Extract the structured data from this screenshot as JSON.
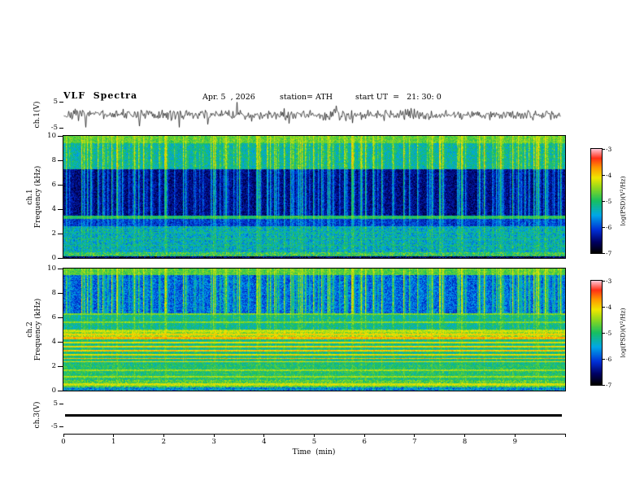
{
  "header": {
    "title": "VLF  Spectra",
    "date": "Apr. 5  , 2026",
    "station": "station= ATH",
    "start_ut": "start UT  =   21: 30: 0"
  },
  "time_axis": {
    "label": "Time  (min)",
    "range": [
      0,
      10
    ],
    "ticks": [
      0,
      1,
      2,
      3,
      4,
      5,
      6,
      7,
      8,
      9,
      10
    ],
    "tick_labels": [
      "0",
      "1",
      "2",
      "3",
      "4",
      "5",
      "6",
      "7",
      "8",
      "9"
    ]
  },
  "colorbar": {
    "label": "log(PSD)(V²/Hz)",
    "tick_labels": [
      "-3",
      "-4",
      "-5",
      "-6",
      "-7"
    ],
    "range": [
      -7,
      -3
    ],
    "stops": [
      [
        0.0,
        "#000000"
      ],
      [
        0.1,
        "#000060"
      ],
      [
        0.22,
        "#0030d8"
      ],
      [
        0.36,
        "#00a8e8"
      ],
      [
        0.5,
        "#18c060"
      ],
      [
        0.62,
        "#8cd820"
      ],
      [
        0.72,
        "#f0e800"
      ],
      [
        0.82,
        "#ff9800"
      ],
      [
        0.91,
        "#ff3018"
      ],
      [
        1.0,
        "#ffc8d8"
      ]
    ]
  },
  "panels": {
    "ch1_wave": {
      "ylabel": "ch.1(V)",
      "ylim": [
        -5,
        5
      ],
      "yticks": [
        5,
        -5
      ],
      "ytick_labels": [
        "5",
        "-5"
      ]
    },
    "ch1_spec": {
      "channel": "ch.1",
      "ylabel": "Frequency  (kHz)",
      "ylim": [
        0,
        10
      ],
      "yticks": [
        10,
        8,
        6,
        4,
        2,
        0
      ],
      "ytick_labels": [
        "10",
        "8",
        "6",
        "4",
        "2",
        "0"
      ]
    },
    "ch2_spec": {
      "channel": "ch.2",
      "ylabel": "Frequency  (kHz)",
      "ylim": [
        0,
        10
      ],
      "yticks": [
        10,
        8,
        6,
        4,
        2,
        0
      ],
      "ytick_labels": [
        "10",
        "8",
        "6",
        "4",
        "2",
        "0"
      ]
    },
    "ch3_wave": {
      "ylabel": "ch.3(V)",
      "ylim": [
        -5,
        5
      ],
      "yticks": [
        5,
        -5
      ],
      "ytick_labels": [
        "5",
        "-5"
      ]
    }
  },
  "chart_data": [
    {
      "type": "line",
      "name": "ch.1 voltage waveform",
      "ylabel": "ch.1(V)",
      "xlabel": "Time (min)",
      "xlim": [
        0,
        10
      ],
      "ylim": [
        -5,
        5
      ],
      "summary": "continuous broadband noise about 0 V, rms ~1 V, impulsive sferic spikes to about +/-4 V",
      "gen": {
        "seed": 7,
        "rms": 0.95,
        "spike_prob": 0.03,
        "spike_amp": [
          2.0,
          4.3
        ],
        "clip": 4.8
      }
    },
    {
      "type": "heatmap",
      "name": "ch.1 spectrogram",
      "ylabel": "Frequency (kHz)",
      "xlabel": "Time (min)",
      "zlabel": "log(PSD)(V²/Hz)",
      "xlim": [
        0,
        10
      ],
      "ylim": [
        0,
        10
      ],
      "zlim": [
        -7,
        -3
      ],
      "noise_seed": 3,
      "streaks": {
        "seed": 11,
        "prob": 0.22,
        "amp": [
          0.4,
          1.35
        ],
        "decay": 0.45
      },
      "bands": [
        {
          "f": [
            0.0,
            0.15
          ],
          "level": -6.6,
          "sigma": 0.5,
          "streak": 0.05
        },
        {
          "f": [
            0.15,
            0.45
          ],
          "level": -4.95,
          "sigma": 0.55,
          "streak": 0.1
        },
        {
          "f": [
            0.45,
            2.6
          ],
          "level": -5.45,
          "sigma": 0.5,
          "streak": 0.3
        },
        {
          "f": [
            2.6,
            3.2
          ],
          "level": -6.15,
          "sigma": 0.35,
          "streak": 0.5
        },
        {
          "f": [
            3.2,
            3.5
          ],
          "level": -5.05,
          "sigma": 0.25,
          "streak": 0.3
        },
        {
          "f": [
            3.5,
            7.3
          ],
          "level": -6.55,
          "sigma": 0.3,
          "streak": 1.15
        },
        {
          "f": [
            7.3,
            9.4
          ],
          "level": -5.35,
          "sigma": 0.4,
          "streak": 0.9
        },
        {
          "f": [
            9.4,
            10.01
          ],
          "level": -4.75,
          "sigma": 0.3,
          "streak": 0.4
        }
      ],
      "lines": [
        {
          "f": 1.05,
          "level": -5.15,
          "w": 0.08
        },
        {
          "f": 1.55,
          "level": -5.1,
          "w": 0.08
        },
        {
          "f": 2.1,
          "level": -5.2,
          "w": 0.08
        }
      ]
    },
    {
      "type": "heatmap",
      "name": "ch.2 spectrogram",
      "ylabel": "Frequency (kHz)",
      "xlabel": "Time (min)",
      "zlabel": "log(PSD)(V²/Hz)",
      "xlim": [
        0,
        10
      ],
      "ylim": [
        0,
        10
      ],
      "zlim": [
        -7,
        -3
      ],
      "noise_seed": 5,
      "streaks": {
        "seed": 11,
        "prob": 0.22,
        "amp": [
          0.4,
          1.35
        ],
        "decay": 0.45
      },
      "bands": [
        {
          "f": [
            0.0,
            0.3
          ],
          "level": -5.6,
          "sigma": 0.55,
          "streak": 0.05
        },
        {
          "f": [
            0.3,
            0.9
          ],
          "level": -4.8,
          "sigma": 0.45,
          "streak": 0.1
        },
        {
          "f": [
            0.9,
            2.1
          ],
          "level": -5.05,
          "sigma": 0.35,
          "streak": 0.15
        },
        {
          "f": [
            2.1,
            4.2
          ],
          "level": -5.15,
          "sigma": 0.35,
          "streak": 0.2
        },
        {
          "f": [
            4.2,
            5.0
          ],
          "level": -4.5,
          "sigma": 0.35,
          "streak": 0.2
        },
        {
          "f": [
            5.0,
            6.3
          ],
          "level": -5.25,
          "sigma": 0.35,
          "streak": 0.4
        },
        {
          "f": [
            6.3,
            9.5
          ],
          "level": -5.95,
          "sigma": 0.4,
          "streak": 1.25
        },
        {
          "f": [
            9.5,
            10.01
          ],
          "level": -4.8,
          "sigma": 0.3,
          "streak": 0.4
        }
      ],
      "lines": [
        {
          "f": 0.5,
          "level": -4.25,
          "w": 0.15
        },
        {
          "f": 1.15,
          "level": -4.45,
          "w": 0.12
        },
        {
          "f": 1.65,
          "level": -4.45,
          "w": 0.12
        },
        {
          "f": 2.35,
          "level": -4.1,
          "w": 0.1
        },
        {
          "f": 2.65,
          "level": -3.9,
          "w": 0.1
        },
        {
          "f": 2.95,
          "level": -4.1,
          "w": 0.1
        },
        {
          "f": 3.25,
          "level": -3.95,
          "w": 0.12
        },
        {
          "f": 3.6,
          "level": -4.05,
          "w": 0.1
        },
        {
          "f": 3.95,
          "level": -4.15,
          "w": 0.1
        },
        {
          "f": 4.3,
          "level": -3.85,
          "w": 0.14
        },
        {
          "f": 4.6,
          "level": -4.05,
          "w": 0.16
        },
        {
          "f": 4.85,
          "level": -4.3,
          "w": 0.12
        },
        {
          "f": 5.6,
          "level": -4.55,
          "w": 0.12
        },
        {
          "f": 6.25,
          "level": -4.6,
          "w": 0.16
        }
      ]
    },
    {
      "type": "line",
      "name": "ch.3 voltage waveform",
      "ylabel": "ch.3(V)",
      "xlim": [
        0,
        10
      ],
      "ylim": [
        -5,
        5
      ],
      "summary": "flat constant trace at about 0 V across the full record",
      "value": 0
    }
  ]
}
